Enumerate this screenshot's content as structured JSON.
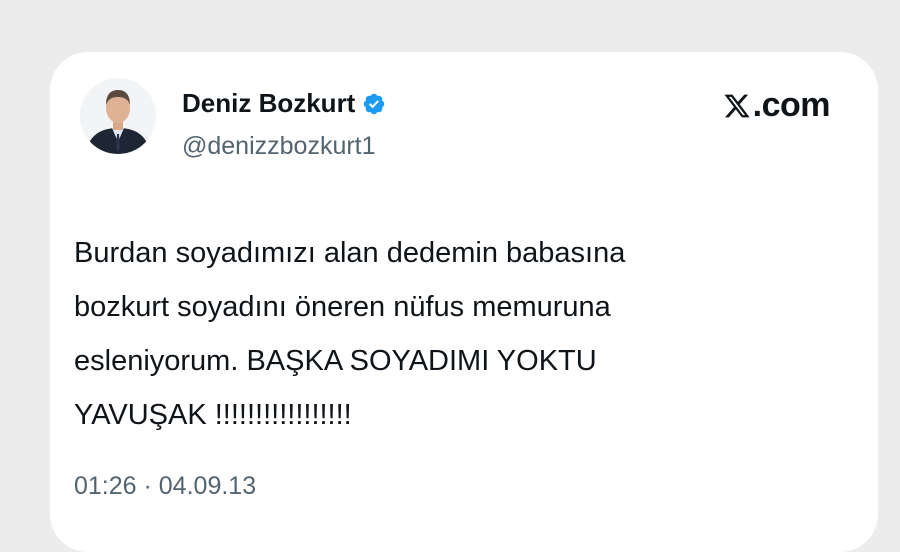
{
  "author": {
    "display_name": "Deniz Bozkurt",
    "handle": "@denizzbozkurt1",
    "verified": true,
    "verified_icon": "verified-badge-icon",
    "avatar_icon": "profile-photo"
  },
  "brand": {
    "logo_icon": "x-logo-icon",
    "text": ".com"
  },
  "tweet": {
    "lines": [
      "Burdan soyadımızı alan dedemin babasına",
      "bozkurt soyadını öneren nüfus memuruna",
      "esleniyorum. BAŞKA SOYADIMI YOKTU",
      "YAVUŞAK !!!!!!!!!!!!!!!!!"
    ]
  },
  "meta": {
    "time": "01:26",
    "separator": " · ",
    "date": "04.09.13"
  },
  "colors": {
    "background": "#ececec",
    "card": "#ffffff",
    "text": "#0f1419",
    "secondary": "#536471",
    "verified": "#1d9bf0"
  }
}
